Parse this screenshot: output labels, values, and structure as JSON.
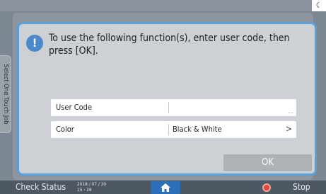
{
  "dialog": {
    "message": "To use the following function(s), enter user code, then press [OK].",
    "icon": "info-alert-icon",
    "rows": [
      {
        "label": "User Code",
        "value": "",
        "affordance": "..."
      },
      {
        "label": "Color",
        "value": "Black & White",
        "affordance": ">"
      }
    ],
    "ok_label": "OK"
  },
  "side_tab": {
    "label": "Select One Touch Job"
  },
  "statusbar": {
    "check_status": "Check Status",
    "date": "2018 / 07 / 30",
    "time": "15 : 28",
    "stop_label": "Stop"
  },
  "colors": {
    "dialog_border": "#5b9fd9",
    "home_button": "#2b6fb7",
    "stop_button": "#e0493b"
  }
}
